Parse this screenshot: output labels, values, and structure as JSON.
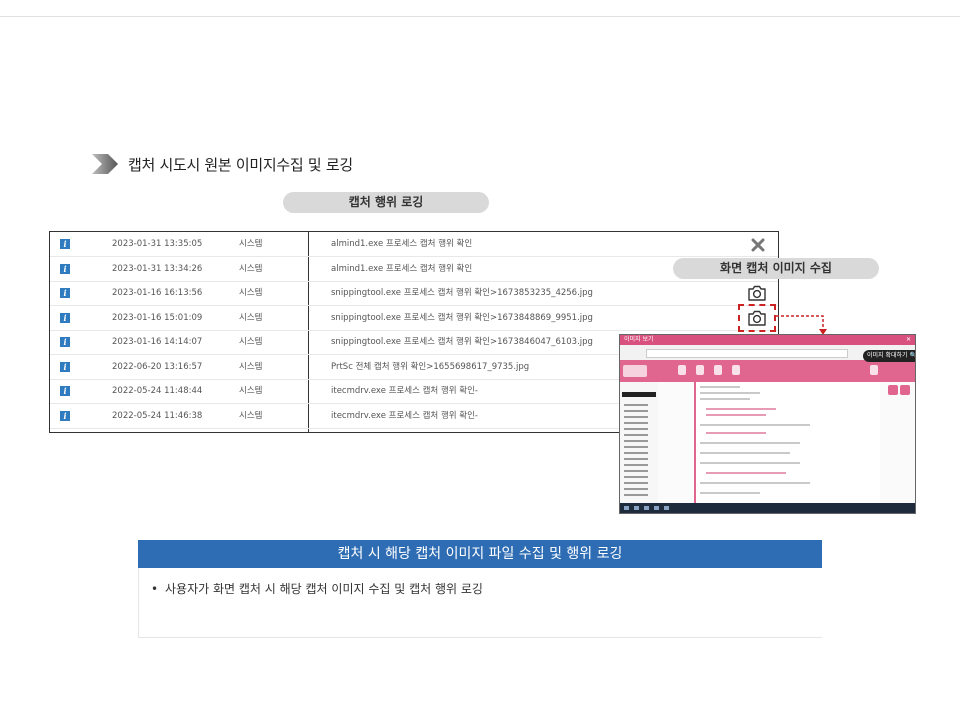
{
  "section": {
    "title": "캡처 시도시 원본 이미지수집 및 로깅"
  },
  "pills": {
    "logging": "캡처 행위 로깅",
    "capture": "화면 캡처 이미지 수집"
  },
  "log_rows": [
    {
      "date": "2023-01-31 13:35:05",
      "actor": "시스템",
      "message": "almind1.exe 프로세스 캡처 행위 확인",
      "action": "close-icon"
    },
    {
      "date": "2023-01-31 13:34:26",
      "actor": "시스템",
      "message": "almind1.exe 프로세스 캡처 행위 확인",
      "action": ""
    },
    {
      "date": "2023-01-16 16:13:56",
      "actor": "시스템",
      "message": "snippingtool.exe 프로세스 캡처 행위 확인>1673853235_4256.jpg",
      "action": "camera-icon"
    },
    {
      "date": "2023-01-16 15:01:09",
      "actor": "시스템",
      "message": "snippingtool.exe 프로세스 캡처 행위 확인>1673848869_9951.jpg",
      "action": "camera-icon"
    },
    {
      "date": "2023-01-16 14:14:07",
      "actor": "시스템",
      "message": "snippingtool.exe 프로세스 캡처 행위 확인>1673846047_6103.jpg",
      "action": ""
    },
    {
      "date": "2022-06-20 13:16:57",
      "actor": "시스템",
      "message": "PrtSc 전체 캡처 행위 확인>1655698617_9735.jpg",
      "action": ""
    },
    {
      "date": "2022-05-24 11:48:44",
      "actor": "시스템",
      "message": "itecmdrv.exe 프로세스 캡처 행위 확인-",
      "action": ""
    },
    {
      "date": "2022-05-24 11:46:38",
      "actor": "시스템",
      "message": "itecmdrv.exe 프로세스 캡처 행위 확인-",
      "action": ""
    }
  ],
  "screenshot": {
    "window_title": "이미지 보기",
    "zoom_button": "이미지 확대하기"
  },
  "summary": {
    "title": "캡처 시 해당 캡처 이미지 파일 수집 및 행위 로깅",
    "items": [
      "사용자가 화면 캡처 시 해당 캡처 이미지 수집 및 캡처 행위 로깅"
    ]
  },
  "colors": {
    "accent_blue": "#2e6db4",
    "highlight_red": "#cc2222",
    "app_pink": "#e0668f"
  }
}
